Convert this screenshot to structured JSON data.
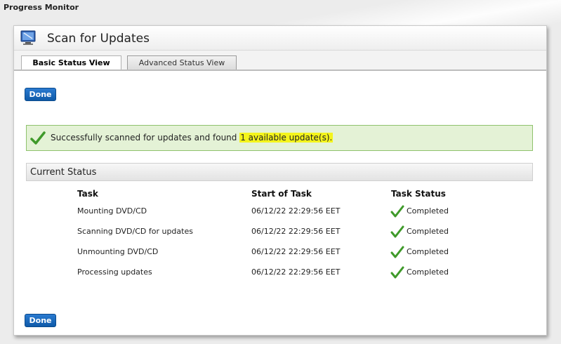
{
  "window": {
    "title": "Progress Monitor"
  },
  "panel": {
    "title": "Scan for Updates",
    "icon": "monitor-icon"
  },
  "tabs": [
    {
      "label": "Basic Status View",
      "active": true
    },
    {
      "label": "Advanced Status View",
      "active": false
    }
  ],
  "buttons": {
    "done_label": "Done"
  },
  "message": {
    "prefix": "Successfully scanned for updates and found ",
    "highlight": "1 available update(s)",
    "suffix": ".",
    "highlight_color": "#f4f41c",
    "icon": "checkmark-icon"
  },
  "current_status": {
    "title": "Current Status",
    "columns": [
      "Task",
      "Start of Task",
      "Task Status"
    ],
    "rows": [
      {
        "task": "Mounting DVD/CD",
        "start": "06/12/22 22:29:56 EET",
        "status": "Completed"
      },
      {
        "task": "Scanning DVD/CD for updates",
        "start": "06/12/22 22:29:56 EET",
        "status": "Completed"
      },
      {
        "task": "Unmounting DVD/CD",
        "start": "06/12/22 22:29:56 EET",
        "status": "Completed"
      },
      {
        "task": "Processing updates",
        "start": "06/12/22 22:29:56 EET",
        "status": "Completed"
      }
    ]
  },
  "colors": {
    "accent": "#0e5aa8",
    "success_bg": "#e4f2d6",
    "success_border": "#8fc26d",
    "check": "#3f9a2a"
  }
}
